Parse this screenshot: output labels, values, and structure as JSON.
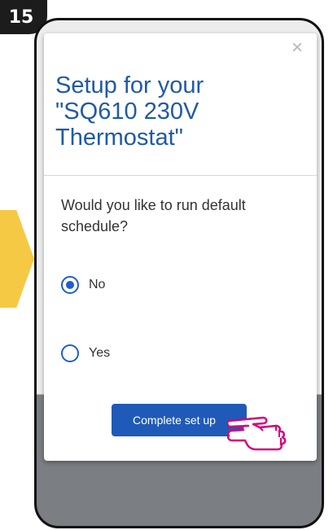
{
  "step": {
    "number": "15"
  },
  "dialog": {
    "title_lines": [
      "Setup for your",
      "\"SQ610 230V",
      "Thermostat\""
    ],
    "question": "Would you like to run default schedule?",
    "options": [
      {
        "label": "No",
        "selected": true
      },
      {
        "label": "Yes",
        "selected": false
      }
    ],
    "complete_label": "Complete set up",
    "close_symbol": "×"
  },
  "colors": {
    "accent": "#1f5ab8",
    "title": "#1f5aa8",
    "arrow": "#f6c945",
    "pointer": "#d6007a"
  },
  "icons": {
    "close": "close-icon",
    "pointer": "pointing-hand-icon"
  }
}
